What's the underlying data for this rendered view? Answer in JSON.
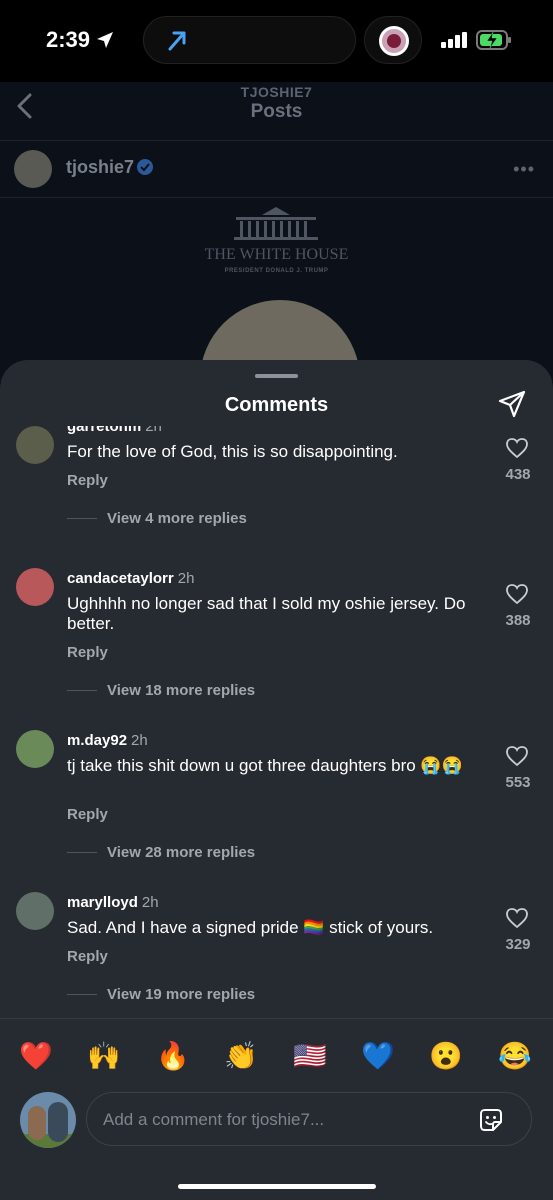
{
  "status_bar": {
    "time": "2:39"
  },
  "post": {
    "nav_subtitle": "TJOSHIE7",
    "nav_title": "Posts",
    "username": "tjoshie7",
    "image_title": "THE WHITE HOUSE",
    "image_subtitle": "PRESIDENT DONALD J. TRUMP"
  },
  "sheet": {
    "title": "Comments"
  },
  "comments": [
    {
      "user": "garretonm",
      "time": "2h",
      "text": "For the love of God, this is so disappointing.",
      "reply": "Reply",
      "likes": "438",
      "view_replies": "View 4 more replies",
      "avatar_color": "#5b5e4a"
    },
    {
      "user": "candacetaylorr",
      "time": "2h",
      "text": "Ughhhh no longer sad that I sold my oshie jersey. Do better.",
      "reply": "Reply",
      "likes": "388",
      "view_replies": "View 18 more replies",
      "avatar_color": "#b8585a"
    },
    {
      "user": "m.day92",
      "time": "2h",
      "text": "tj take this shit down u got three daughters bro 😭😭",
      "reply": "Reply",
      "likes": "553",
      "view_replies": "View 28 more replies",
      "avatar_color": "#6a8a5a"
    },
    {
      "user": "marylloyd",
      "time": "2h",
      "text": "Sad. And I have a signed pride 🏳️‍🌈 stick of yours.",
      "reply": "Reply",
      "likes": "329",
      "view_replies": "View 19 more replies",
      "avatar_color": "#607068"
    }
  ],
  "emojis": [
    "❤️",
    "🙌",
    "🔥",
    "👏",
    "🇺🇸",
    "💙",
    "😮",
    "😂"
  ],
  "composer": {
    "placeholder": "Add a comment for tjoshie7..."
  }
}
